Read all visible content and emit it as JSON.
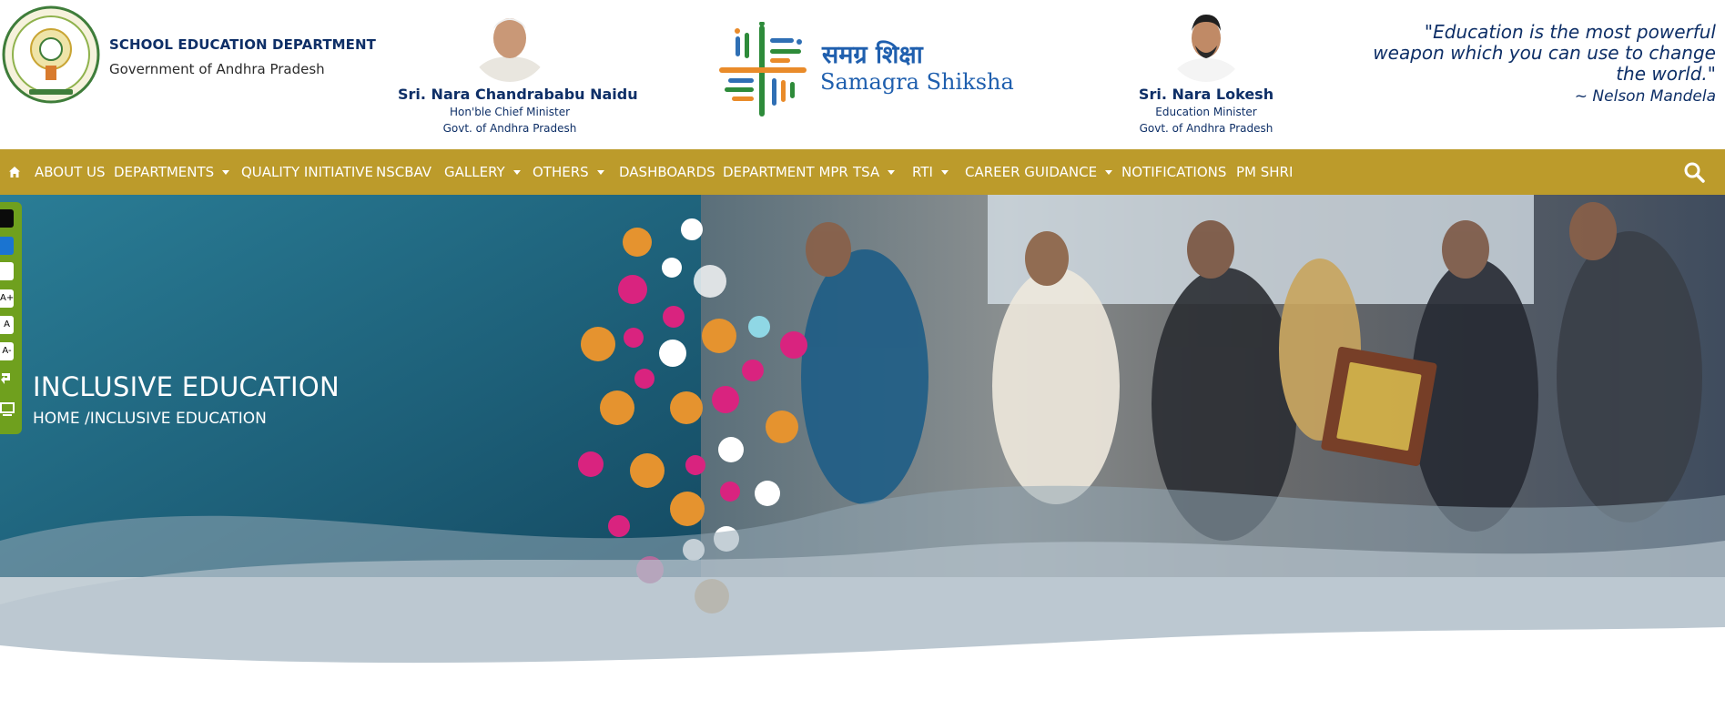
{
  "header": {
    "dept_title": "SCHOOL EDUCATION DEPARTMENT",
    "dept_subtitle": "Government of Andhra Pradesh",
    "cm": {
      "name": "Sri. Nara Chandrababu Naidu",
      "role": "Hon'ble Chief Minister",
      "gov": "Govt. of Andhra Pradesh"
    },
    "minister": {
      "name": "Sri. Nara Lokesh",
      "role": "Education Minister",
      "gov": "Govt. of Andhra Pradesh"
    },
    "logo_hindi": "समग्र शिक्षा",
    "logo_english": "Samagra Shiksha",
    "quote": "\"Education is the most powerful weapon which you can use to change the world.\"",
    "quote_author": "~ Nelson Mandela"
  },
  "nav": {
    "items": [
      {
        "label": "ABOUT US",
        "dropdown": false
      },
      {
        "label": "DEPARTMENTS",
        "dropdown": true
      },
      {
        "label": "QUALITY INITIATIVE",
        "dropdown": false
      },
      {
        "label": "NSCBAV",
        "dropdown": false
      },
      {
        "label": "GALLERY",
        "dropdown": true
      },
      {
        "label": "OTHERS",
        "dropdown": true
      },
      {
        "label": "DASHBOARDS",
        "dropdown": false
      },
      {
        "label": "DEPARTMENT MPR",
        "dropdown": false
      },
      {
        "label": "TSA",
        "dropdown": true
      },
      {
        "label": "RTI",
        "dropdown": true
      },
      {
        "label": "CAREER GUIDANCE",
        "dropdown": true
      },
      {
        "label": "NOTIFICATIONS",
        "dropdown": false
      },
      {
        "label": "PM SHRI",
        "dropdown": false
      }
    ]
  },
  "hero": {
    "title": "INCLUSIVE EDUCATION",
    "breadcrumb": "HOME /INCLUSIVE EDUCATION"
  },
  "accessibility": {
    "increase_font": "A+",
    "normal_font": "A",
    "decrease_font": "A-"
  },
  "icons": [
    "home-icon",
    "search-icon",
    "state-emblem-icon",
    "samagra-shiksha-logo",
    "contrast-icon",
    "monitor-icon"
  ],
  "colors": {
    "nav_bg": "#bc9b2b",
    "brand_blue": "#0e2f67",
    "accessibility_bar": "#6fa01e",
    "hero_teal": "#1d5f78"
  }
}
